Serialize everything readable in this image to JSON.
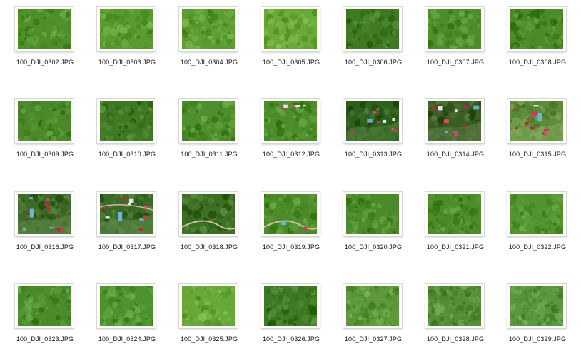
{
  "window": {
    "view": "icon-grid"
  },
  "files": [
    {
      "name": "100_DJI_0302.JPG",
      "thumbnail": "forest",
      "tone": "#4f8f2a"
    },
    {
      "name": "100_DJI_0303.JPG",
      "thumbnail": "forest",
      "tone": "#5a9a30"
    },
    {
      "name": "100_DJI_0304.JPG",
      "thumbnail": "forest",
      "tone": "#5c9c32"
    },
    {
      "name": "100_DJI_0305.JPG",
      "thumbnail": "forest",
      "tone": "#6aa838"
    },
    {
      "name": "100_DJI_0306.JPG",
      "thumbnail": "forest",
      "tone": "#3f7a22"
    },
    {
      "name": "100_DJI_0307.JPG",
      "thumbnail": "forest",
      "tone": "#4e8d2b"
    },
    {
      "name": "100_DJI_0308.JPG",
      "thumbnail": "forest",
      "tone": "#4c8a2a"
    },
    {
      "name": "100_DJI_0309.JPG",
      "thumbnail": "forest",
      "tone": "#4a8828"
    },
    {
      "name": "100_DJI_0310.JPG",
      "thumbnail": "forest",
      "tone": "#3e7822"
    },
    {
      "name": "100_DJI_0311.JPG",
      "thumbnail": "forest",
      "tone": "#4f8e2c"
    },
    {
      "name": "100_DJI_0312.JPG",
      "thumbnail": "village-edge",
      "tone": "#4c8c2a"
    },
    {
      "name": "100_DJI_0313.JPG",
      "thumbnail": "village",
      "tone": "#2f5f1c"
    },
    {
      "name": "100_DJI_0314.JPG",
      "thumbnail": "village",
      "tone": "#3c5d24"
    },
    {
      "name": "100_DJI_0315.JPG",
      "thumbnail": "village-clearing",
      "tone": "#5e8a3a"
    },
    {
      "name": "100_DJI_0316.JPG",
      "thumbnail": "village-clearing",
      "tone": "#3f6a28"
    },
    {
      "name": "100_DJI_0317.JPG",
      "thumbnail": "village-road",
      "tone": "#3a6a25"
    },
    {
      "name": "100_DJI_0318.JPG",
      "thumbnail": "forest-road",
      "tone": "#3d6f24"
    },
    {
      "name": "100_DJI_0319.JPG",
      "thumbnail": "forest-road",
      "tone": "#4d8b2a"
    },
    {
      "name": "100_DJI_0320.JPG",
      "thumbnail": "forest",
      "tone": "#4a8a28"
    },
    {
      "name": "100_DJI_0321.JPG",
      "thumbnail": "forest",
      "tone": "#4d8c2a"
    },
    {
      "name": "100_DJI_0322.JPG",
      "thumbnail": "forest",
      "tone": "#529430"
    },
    {
      "name": "100_DJI_0323.JPG",
      "thumbnail": "forest",
      "tone": "#4a8a2a"
    },
    {
      "name": "100_DJI_0324.JPG",
      "thumbnail": "forest",
      "tone": "#4e9230"
    },
    {
      "name": "100_DJI_0325.JPG",
      "thumbnail": "forest",
      "tone": "#68a83a"
    },
    {
      "name": "100_DJI_0326.JPG",
      "thumbnail": "forest",
      "tone": "#3e7a24"
    },
    {
      "name": "100_DJI_0327.JPG",
      "thumbnail": "palm-grove",
      "tone": "#5e9a3c"
    },
    {
      "name": "100_DJI_0328.JPG",
      "thumbnail": "palm-grove",
      "tone": "#548e38"
    },
    {
      "name": "100_DJI_0329.JPG",
      "thumbnail": "palm-grove",
      "tone": "#5a9840"
    }
  ]
}
